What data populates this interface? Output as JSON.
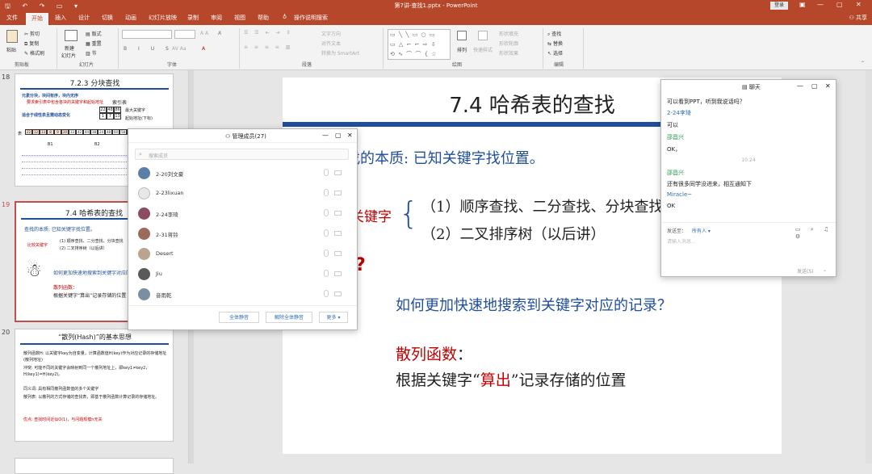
{
  "window": {
    "title": "第7讲-查找1.pptx - PowerPoint",
    "login": "登录",
    "share": "共享"
  },
  "tabs": [
    {
      "label": "文件"
    },
    {
      "label": "开始"
    },
    {
      "label": "插入"
    },
    {
      "label": "设计"
    },
    {
      "label": "切换"
    },
    {
      "label": "动画"
    },
    {
      "label": "幻灯片放映"
    },
    {
      "label": "录制"
    },
    {
      "label": "审阅"
    },
    {
      "label": "视图"
    },
    {
      "label": "帮助"
    },
    {
      "label": "操作说明搜索"
    }
  ],
  "ribbon": {
    "clipboard": {
      "paste": "粘贴",
      "cut": "剪切",
      "copy": "复制",
      "format_painter": "格式刷",
      "group": "剪贴板"
    },
    "slides": {
      "new_slide": "新建",
      "new_slide2": "幻灯片",
      "layout": "版式",
      "reset": "重置",
      "section": "节",
      "group": "幻灯片"
    },
    "font": {
      "group": "字体"
    },
    "paragraph": {
      "text_direction": "文字方向",
      "align_text": "对齐文本",
      "smartart": "转换为 SmartArt",
      "group": "段落"
    },
    "drawing": {
      "arrange": "排列",
      "quick_styles": "快速样式",
      "fill": "形状填充",
      "outline": "形状轮廓",
      "effects": "形状效果",
      "group": "绘图"
    },
    "editing": {
      "find": "查找",
      "replace": "替换",
      "select": "选择",
      "group": "编辑"
    }
  },
  "thumbnails": [
    {
      "num": "18",
      "title": "7.2.3 分块查找",
      "lines": [
        "元素分块，块间有序，块内无序",
        "要求索引表中包含各块的关键字和起始地址",
        "适合于线性表且需动态变化",
        "索引表",
        "最大关键字",
        "起始地址(下标)",
        "表",
        "B1",
        "B2",
        "B3"
      ],
      "idx": [
        "22",
        "48",
        "86",
        "1",
        "7",
        "13"
      ],
      "tbl": [
        "22",
        "12",
        "13",
        "8",
        "9",
        "20",
        "33",
        "42",
        "44",
        "38",
        "24",
        "48",
        "60",
        "58",
        "74",
        "49",
        "86",
        "53"
      ]
    },
    {
      "num": "19",
      "title": "7.4 哈希表的查找",
      "lines": [
        "查找的本质: 已知关键字找位置。",
        "比较关键字",
        "(1) 顺序查找、二分查找、分块查找",
        "(2) 二叉排序树（以后讲）",
        "如何更加快速地搜索到关键字对应的记录？",
        "散列函数：",
        "根据关键字“算出”记录存储的位置"
      ]
    },
    {
      "num": "20",
      "title": "“散列(Hash)”的基本思想",
      "lines": [
        "散列函数H: 以关键字key为自变量，计算函数值H(key)作为对应记录的存储地址(散列地址)",
        "冲突: 可能不同的关键字会映射到同一个散列地址上，即key1≠key2，H(key1)=H(key2)。",
        "同义词: 具有相同散列函数值的多个关键字",
        "散列表: 以散列的方式存储的查找表，即基于散列函数计算记录的存储地址。",
        "优点: 查找时间近似O(1)，与问题规模n无关"
      ]
    }
  ],
  "slide": {
    "title": "7.4 哈希表的查找",
    "essence_label": "查找的本质",
    "essence_text": ": 已知关键字找位置。",
    "compare_label": "比较关键字",
    "item1": "（1）顺序查找、二分查找、分块查找",
    "item2": "（2）二叉排序树（以后讲）",
    "question_mark": "?",
    "question": "如何更加快速地搜索到关键字对应的记录？",
    "hash_label": "散列函数",
    "hash_colon": "：",
    "desc_pre": "根据关键字“",
    "desc_red": "算出",
    "desc_post": "”记录存储的位置"
  },
  "members_dialog": {
    "title": "管理成员(27)",
    "search_placeholder": "搜索成员",
    "members": [
      {
        "name": "2-20刘文豪",
        "color": "#5b7fa6"
      },
      {
        "name": "2-23lixuan",
        "color": "#d9d9d9"
      },
      {
        "name": "2-24李琦",
        "color": "#8a4b63"
      },
      {
        "name": "2-31蒋铃",
        "color": "#9c6b5a"
      },
      {
        "name": "Desert",
        "color": "#b9a58f"
      },
      {
        "name": "Jiu",
        "color": "#5a5a5a"
      },
      {
        "name": "音雨乾",
        "color": "#7b8fa3"
      }
    ],
    "mute_all": "全体静音",
    "unmute_all": "解除全体静音",
    "more": "更多 ▾"
  },
  "chat": {
    "title": "聊天",
    "messages": [
      {
        "name": "",
        "text": "可以看到PPT，听到我说话吗？"
      },
      {
        "name": "2-24李琦",
        "text": "可以"
      },
      {
        "name": "邵昌兴",
        "text": "OK，"
      },
      {
        "name": "",
        "text": "10:24"
      },
      {
        "name": "邵昌兴",
        "text": "还有很多同学没进来，相互通知下"
      },
      {
        "name": "Miracle~",
        "text": "OK"
      }
    ],
    "send_to_label": "发送至：",
    "send_to_value": "所有人 ▾",
    "input_placeholder": "请输入消息...",
    "send_button": "发送(S)"
  }
}
